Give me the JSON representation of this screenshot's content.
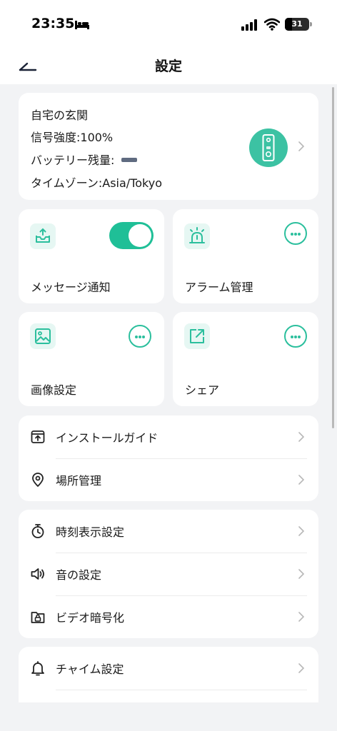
{
  "status_bar": {
    "time": "23:35",
    "battery_level": "31"
  },
  "header": {
    "title": "設定"
  },
  "device": {
    "name": "自宅の玄関",
    "signal": "信号強度:100%",
    "battery_label": "バッテリー残量:",
    "timezone": "タイムゾーン:Asia/Tokyo"
  },
  "tiles": {
    "message": {
      "label": "メッセージ通知",
      "enabled": true
    },
    "alarm": {
      "label": "アラーム管理"
    },
    "image": {
      "label": "画像設定"
    },
    "share": {
      "label": "シェア"
    }
  },
  "groups": [
    {
      "items": [
        {
          "label": "インストールガイド",
          "icon": "install-guide-icon"
        },
        {
          "label": "場所管理",
          "icon": "location-pin-icon"
        }
      ]
    },
    {
      "items": [
        {
          "label": "時刻表示設定",
          "icon": "timer-icon"
        },
        {
          "label": "音の設定",
          "icon": "speaker-icon"
        },
        {
          "label": "ビデオ暗号化",
          "icon": "folder-lock-icon"
        }
      ]
    },
    {
      "items": [
        {
          "label": "チャイム設定",
          "icon": "bell-icon"
        }
      ]
    }
  ],
  "colors": {
    "accent": "#2bbf9d",
    "toggle_on": "#1fbf97",
    "background": "#f2f3f5"
  }
}
